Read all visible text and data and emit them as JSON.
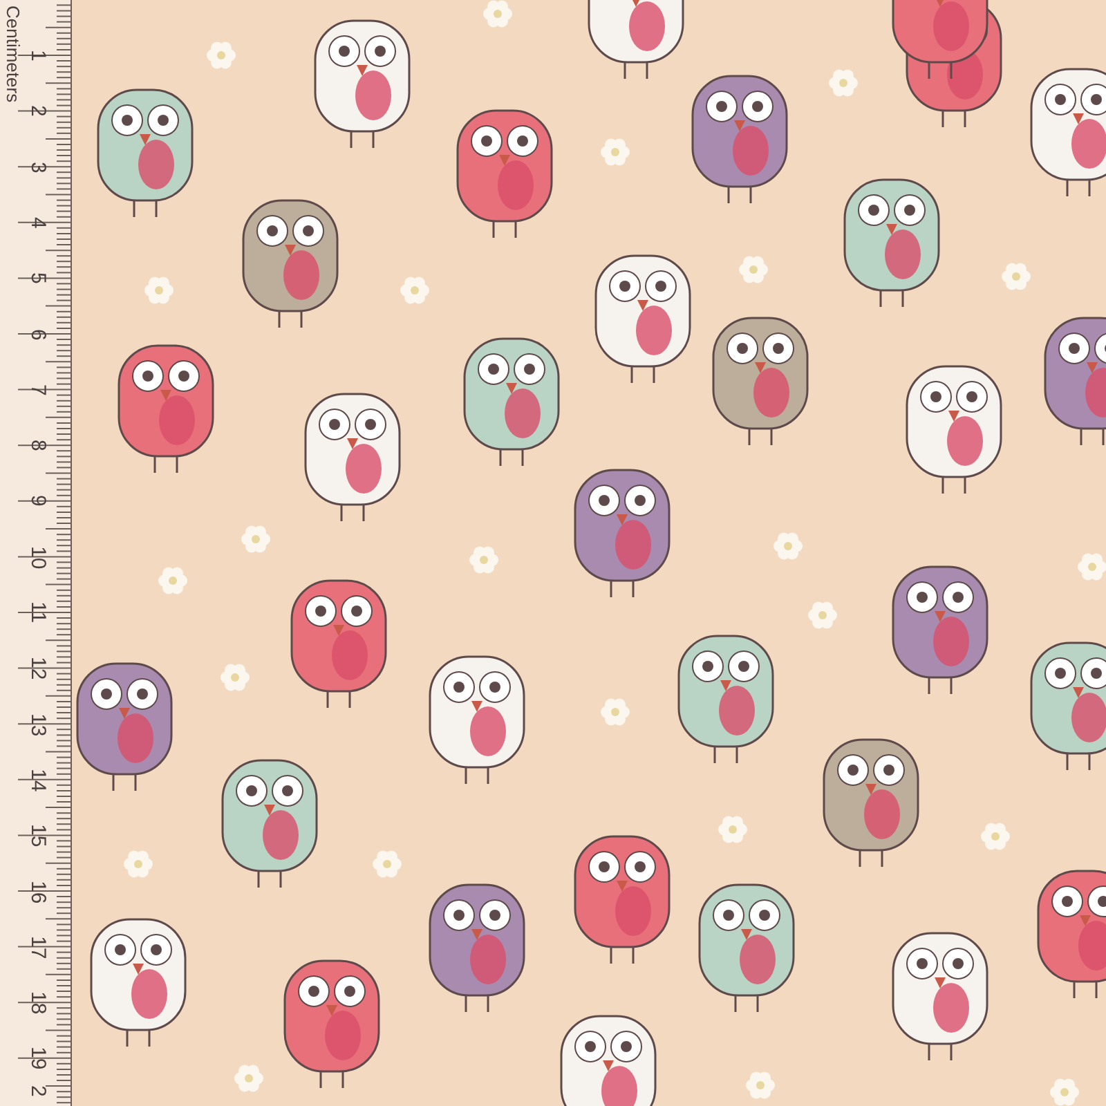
{
  "ruler": {
    "unit_label": "Centimeters",
    "marks": [
      "1",
      "2",
      "3",
      "4",
      "5",
      "6",
      "7",
      "8",
      "9",
      "10",
      "11",
      "12",
      "13",
      "14",
      "15",
      "16",
      "17",
      "18",
      "19",
      "2"
    ]
  }
}
